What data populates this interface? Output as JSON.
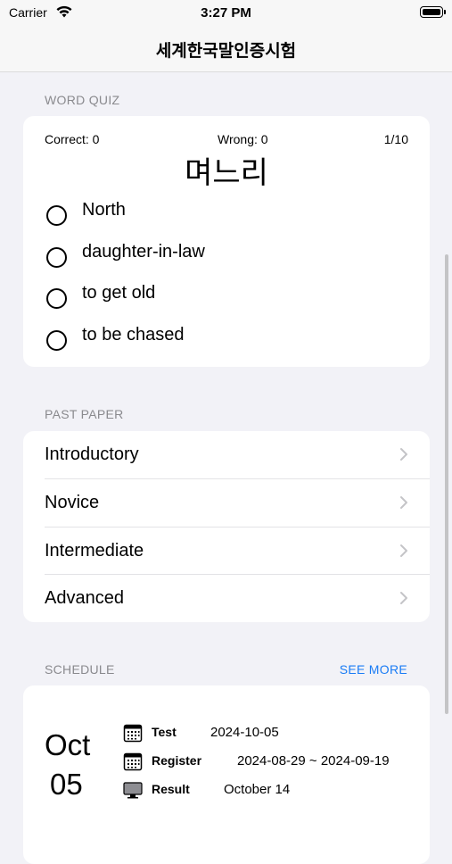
{
  "status": {
    "carrier": "Carrier",
    "time": "3:27 PM"
  },
  "nav": {
    "title": "세계한국말인증시험"
  },
  "quiz": {
    "section": "WORD QUIZ",
    "correct": "Correct: 0",
    "wrong": "Wrong: 0",
    "progress": "1/10",
    "word": "며느리",
    "options": [
      "North",
      "daughter-in-law",
      "to get old",
      "to be chased"
    ]
  },
  "past_paper": {
    "section": "PAST PAPER",
    "items": [
      "Introductory",
      "Novice",
      "Intermediate",
      "Advanced"
    ]
  },
  "schedule": {
    "section": "SCHEDULE",
    "see_more": "SEE MORE",
    "month": "Oct",
    "day": "05",
    "items": [
      {
        "label": "Test",
        "value": "2024-10-05",
        "icon": "calendar-icon"
      },
      {
        "label": "Register",
        "value": "2024-08-29 ~ 2024-09-19",
        "icon": "calendar-icon"
      },
      {
        "label": "Result",
        "value": "October 14",
        "icon": "monitor-icon"
      }
    ]
  },
  "colors": {
    "accent": "#1a7cf5",
    "background": "#f2f2f7",
    "card": "#ffffff"
  }
}
